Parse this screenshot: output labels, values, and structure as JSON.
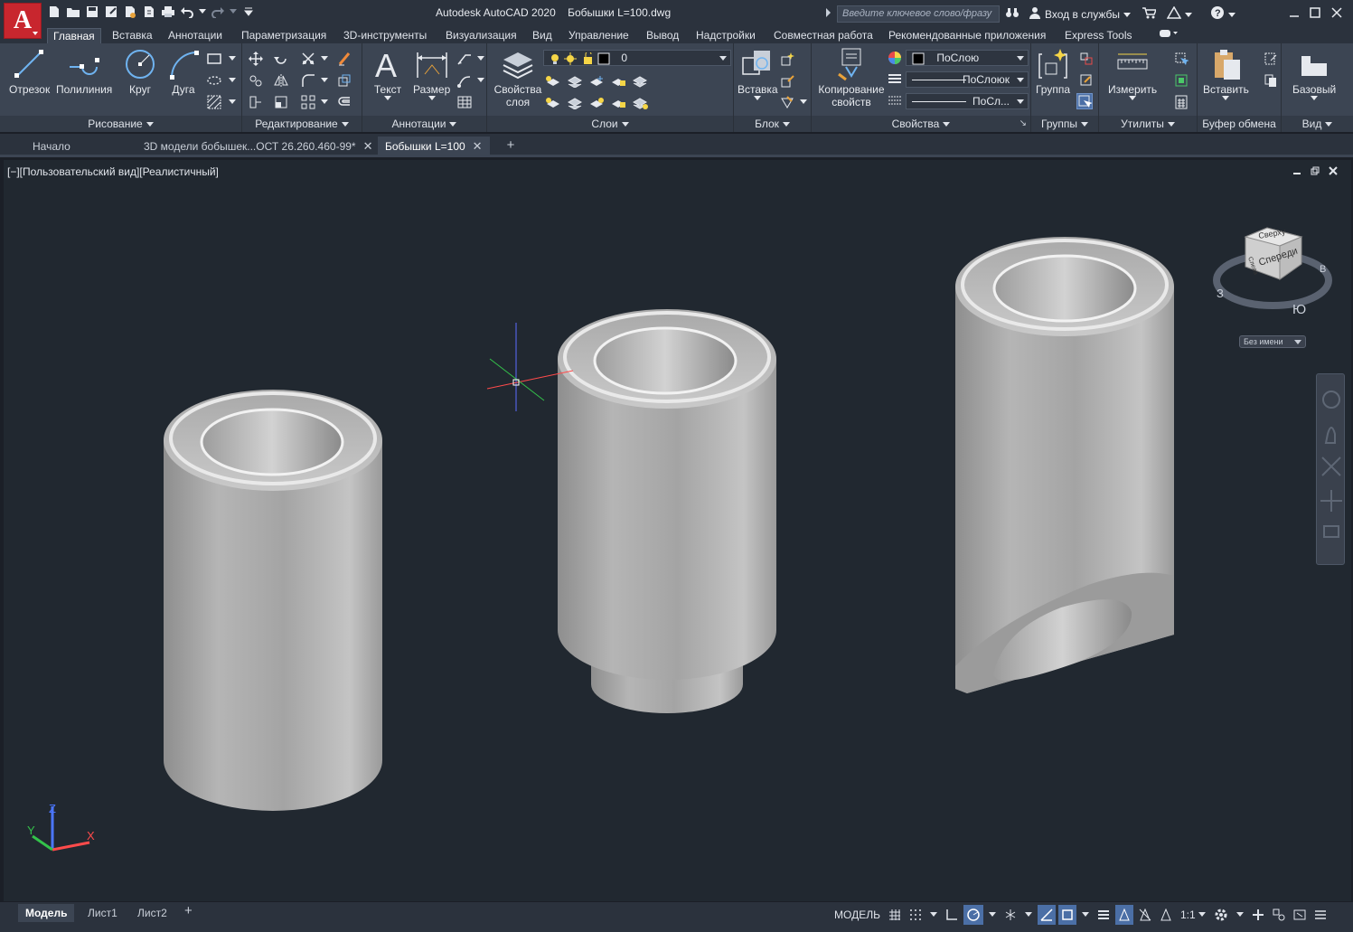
{
  "titlebar": {
    "app_title": "Autodesk AutoCAD 2020",
    "document_title": "Бобышки L=100.dwg",
    "search_placeholder": "Введите ключевое слово/фразу",
    "sign_in": "Вход в службы"
  },
  "ribbon_tabs": [
    "Главная",
    "Вставка",
    "Аннотации",
    "Параметризация",
    "3D-инструменты",
    "Визуализация",
    "Вид",
    "Управление",
    "Вывод",
    "Надстройки",
    "Совместная работа",
    "Рекомендованные приложения",
    "Express Tools"
  ],
  "active_ribbon_tab": "Главная",
  "panels": {
    "draw": {
      "title": "Рисование",
      "tools": [
        "Отрезок",
        "Полилиния",
        "Круг",
        "Дуга"
      ]
    },
    "modify": {
      "title": "Редактирование"
    },
    "annotation": {
      "title": "Аннотации",
      "tools": [
        "Текст",
        "Размер"
      ]
    },
    "layers": {
      "title": "Слои",
      "tool": "Свойства слоя",
      "layer_name": "0"
    },
    "block": {
      "title": "Блок",
      "tool": "Вставка"
    },
    "properties": {
      "title": "Свойства",
      "tool": "Копирование свойств",
      "color": "ПоСлою",
      "linetype": "ПоСлоюк",
      "lineweight": "ПоСл..."
    },
    "groups": {
      "title": "Группы",
      "tool": "Группа"
    },
    "utilities": {
      "title": "Утилиты",
      "tool": "Измерить"
    },
    "clipboard": {
      "title": "Буфер обмена",
      "tool": "Вставить"
    },
    "view": {
      "title": "Вид",
      "tool": "Базовый"
    }
  },
  "file_tabs": [
    {
      "label": "Начало",
      "closable": false,
      "active": false
    },
    {
      "label": "3D модели бобышек...ОСТ 26.260.460-99*",
      "closable": true,
      "active": false
    },
    {
      "label": "Бобышки L=100",
      "closable": true,
      "active": true
    }
  ],
  "viewport": {
    "label": "[−][Пользовательский вид][Реалистичный]",
    "viewcube": {
      "top": "Сверху",
      "front": "Спереди",
      "left": "Слева",
      "compass_w": "З",
      "compass_e": "В",
      "compass_s": "Ю"
    },
    "ucs_name": "Без имени"
  },
  "layout_tabs": [
    "Модель",
    "Лист1",
    "Лист2"
  ],
  "status_bar": {
    "space": "МОДЕЛЬ",
    "scale": "1:1"
  },
  "colors": {
    "background": "#212830",
    "ribbon": "#3c4553",
    "accent": "#c8262e",
    "status_on": "#4b6fa6"
  }
}
